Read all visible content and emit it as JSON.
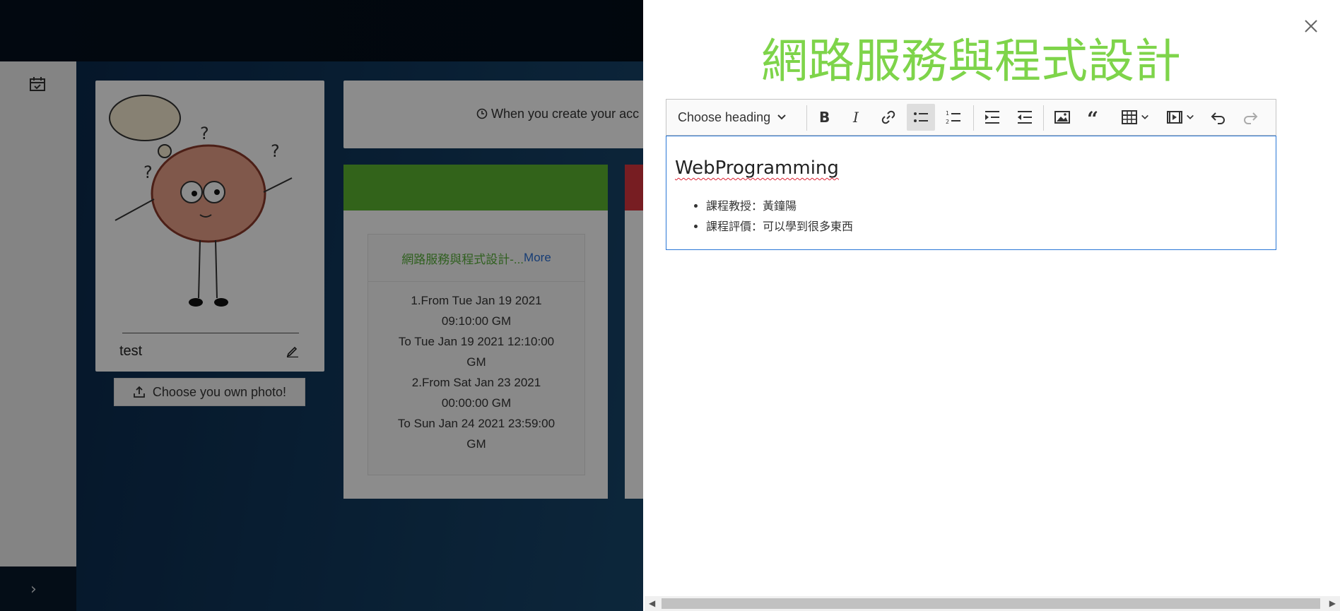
{
  "background": {
    "profile": {
      "name": "test",
      "photo_button": "Choose you own photo!"
    },
    "notice": {
      "text": "When you create your acc"
    },
    "course_card": {
      "title": "網路服務與程式設計-...",
      "more": "More",
      "time_lines": [
        "1.From Tue Jan 19 2021",
        "09:10:00 GM",
        "To Tue Jan 19 2021 12:10:00",
        "GM",
        "2.From Sat Jan 23 2021",
        "00:00:00 GM",
        "To Sun Jan 24 2021 23:59:00",
        "GM"
      ],
      "band_color": "#5cb431"
    },
    "second_card_band_color": "#d9363e"
  },
  "drawer": {
    "title": "網路服務與程式設計",
    "title_color": "#7ed44a",
    "toolbar": {
      "heading_dropdown": "Choose heading",
      "buttons": [
        "bold-icon",
        "italic-icon",
        "link-icon",
        "bulleted-list-icon",
        "numbered-list-icon",
        "indent-icon",
        "outdent-icon",
        "image-icon",
        "quote-icon",
        "table-icon",
        "media-icon",
        "undo-icon",
        "redo-icon"
      ]
    },
    "editor": {
      "heading": "WebProgramming",
      "items": [
        "課程教授：黃鐘陽",
        "課程評價：可以學到很多東西"
      ]
    }
  }
}
